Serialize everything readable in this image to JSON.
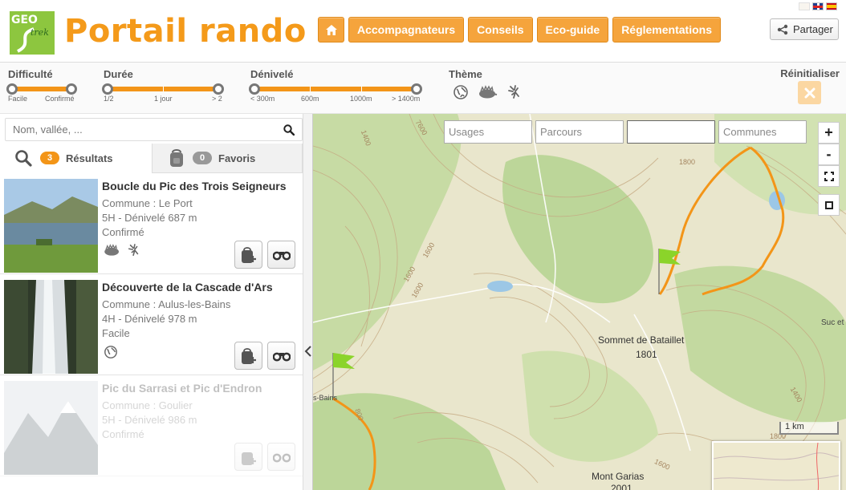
{
  "header": {
    "title": "Portail rando",
    "nav": [
      "Accompagnateurs",
      "Conseils",
      "Eco-guide",
      "Réglementations"
    ],
    "share_label": "Partager",
    "logo_text_top": "GEO",
    "logo_text_bottom": "trek"
  },
  "filters": {
    "difficulty": {
      "label": "Difficulté",
      "min_label": "Facile",
      "max_label": "Confirmé"
    },
    "duration": {
      "label": "Durée",
      "ticks": [
        "1/2",
        "1 jour",
        "> 2"
      ]
    },
    "elevation": {
      "label": "Dénivelé",
      "ticks": [
        "< 300m",
        "600m",
        "1000m",
        "> 1400m"
      ]
    },
    "theme": {
      "label": "Thème",
      "icons": [
        "fauna-globe-icon",
        "hedgehog-icon",
        "flower-icon"
      ]
    },
    "reset_label": "Réinitialiser"
  },
  "sidebar": {
    "search_placeholder": "Nom, vallée, ...",
    "tabs": {
      "results": {
        "count": "3",
        "label": "Résultats"
      },
      "favorites": {
        "count": "0",
        "label": "Favoris"
      }
    },
    "items": [
      {
        "title": "Boucle du Pic des Trois Seigneurs",
        "commune": "Commune : Le Port",
        "duration": "5H - Dénivelé 687 m",
        "difficulty": "Confirmé"
      },
      {
        "title": "Découverte de la Cascade d'Ars",
        "commune": "Commune : Aulus-les-Bains",
        "duration": "4H - Dénivelé 978 m",
        "difficulty": "Facile"
      },
      {
        "title": "Pic du Sarrasi et Pic d'Endron",
        "commune": "Commune : Goulier",
        "duration": "5H - Dénivelé 986 m",
        "difficulty": "Confirmé"
      }
    ]
  },
  "map": {
    "filters": [
      "Usages",
      "Parcours",
      "",
      "Communes"
    ],
    "zoom_in": "+",
    "zoom_out": "-",
    "scale_label": "1 km",
    "labels": {
      "peak1": "Sommet de Bataillet",
      "peak1_alt": "1801",
      "peak2": "Mont Garias",
      "peak2_alt": "2001",
      "place1": "Suc et",
      "place2": "s-Bains",
      "c1600a": "1600",
      "c1600b": "1600",
      "c1600c": "1600",
      "c1400a": "1400",
      "c1400b": "1400",
      "c1800a": "1800",
      "c1800b": "1800",
      "c800": "800",
      "c7600": "7600",
      "c1600d": "1600"
    }
  }
}
